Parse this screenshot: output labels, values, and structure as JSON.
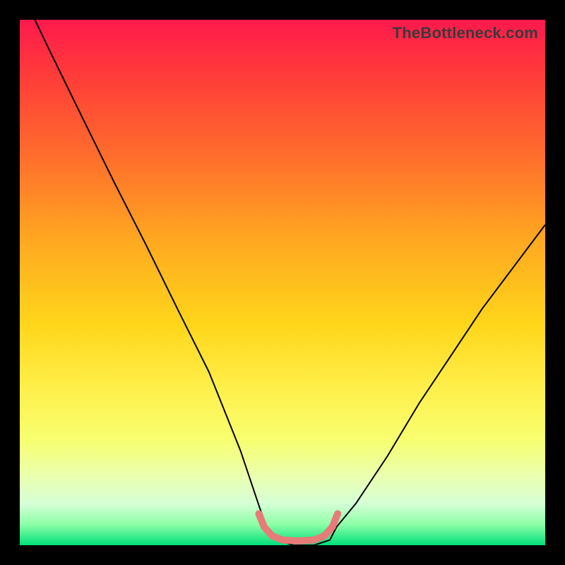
{
  "watermark": {
    "text": "TheBottleneck.com"
  },
  "chart_data": {
    "type": "line",
    "title": "",
    "xlabel": "",
    "ylabel": "",
    "xlim": [
      0,
      1
    ],
    "ylim": [
      0,
      1
    ],
    "series": [
      {
        "name": "bottleneck-curve",
        "stroke": "#000000",
        "stroke_width": 2,
        "x": [
          0.0,
          0.06,
          0.12,
          0.18,
          0.24,
          0.3,
          0.36,
          0.42,
          0.457,
          0.47,
          0.49,
          0.52,
          0.56,
          0.59,
          0.603,
          0.64,
          0.7,
          0.76,
          0.82,
          0.88,
          0.94,
          1.0
        ],
        "values": [
          1.06,
          0.935,
          0.812,
          0.69,
          0.572,
          0.45,
          0.33,
          0.18,
          0.07,
          0.035,
          0.01,
          0.0,
          0.0,
          0.01,
          0.035,
          0.08,
          0.17,
          0.27,
          0.36,
          0.45,
          0.53,
          0.61
        ]
      },
      {
        "name": "optimum-marker",
        "stroke": "#e77b78",
        "stroke_width": 10,
        "x": [
          0.455,
          0.465,
          0.48,
          0.5,
          0.53,
          0.56,
          0.58,
          0.595,
          0.605
        ],
        "values": [
          0.06,
          0.035,
          0.018,
          0.01,
          0.008,
          0.01,
          0.018,
          0.035,
          0.06
        ]
      }
    ]
  }
}
